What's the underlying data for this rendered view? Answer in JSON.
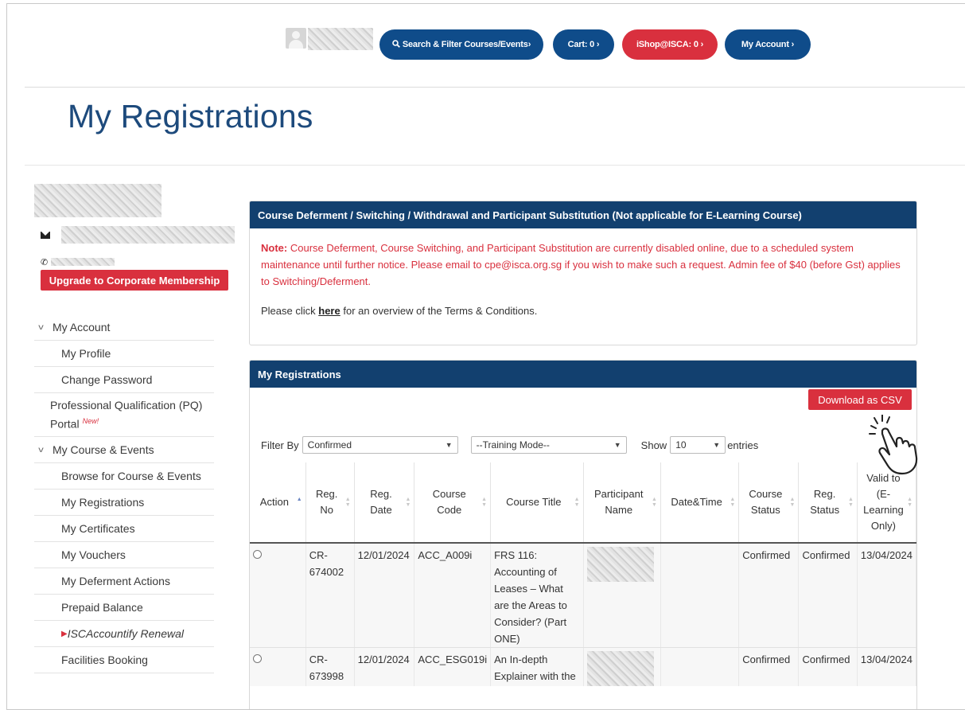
{
  "header": {
    "search_label": "Search & Filter Courses/Events",
    "cart_label": "Cart: 0",
    "ishop_label": "iShop@ISCA: 0",
    "account_label": "My Account",
    "search_icon": "search-icon",
    "chevron": "›"
  },
  "page_title": "My Registrations",
  "sidebar": {
    "upgrade_label": "Upgrade to Corporate Membership",
    "my_account": "My Account",
    "my_profile": "My Profile",
    "change_password": "Change Password",
    "pq_portal": "Professional Qualification (PQ) Portal",
    "new_badge": "New!",
    "my_course_events": "My Course & Events",
    "browse": "Browse for Course & Events",
    "my_registrations": "My Registrations",
    "my_certificates": "My Certificates",
    "my_vouchers": "My Vouchers",
    "my_deferment": "My Deferment Actions",
    "prepaid_balance": "Prepaid Balance",
    "accountify": "ISCAccountify Renewal",
    "facilities": "Facilities Booking"
  },
  "deferment_panel": {
    "title": "Course Deferment / Switching / Withdrawal and Participant Substitution (Not applicable for E-Learning Course)",
    "note_label": "Note:",
    "note_text": "Course Deferment, Course Switching, and Participant Substitution are currently disabled online, due to a scheduled system maintenance until further notice. Please email to cpe@isca.org.sg if you wish to make such a request. Admin fee of $40 (before Gst) applies to Switching/Deferment.",
    "tc_prefix": "Please click",
    "tc_link": "here",
    "tc_suffix": "for an overview of the Terms & Conditions."
  },
  "registrations_panel": {
    "title": "My Registrations",
    "download_label": "Download as CSV",
    "filter_by_label": "Filter By",
    "filter_value": "Confirmed",
    "training_mode_value": "--Training Mode--",
    "show_label": "Show",
    "entries_value": "10",
    "entries_label": "entries",
    "columns": [
      "Action",
      "Reg. No",
      "Reg. Date",
      "Course Code",
      "Course Title",
      "Participant Name",
      "Date&Time",
      "Course Status",
      "Reg. Status",
      "Valid to (E-Learning Only)"
    ],
    "rows": [
      {
        "reg_no": "CR-674002",
        "reg_date": "12/01/2024",
        "course_code": "ACC_A009i",
        "course_title": "FRS 116: Accounting of Leases – What are the Areas to Consider? (Part ONE)",
        "date_time": "",
        "course_status": "Confirmed",
        "reg_status": "Confirmed",
        "valid_to": "13/04/2024"
      },
      {
        "reg_no": "CR-673998",
        "reg_date": "12/01/2024",
        "course_code": "ACC_ESG019i",
        "course_title": "An In-depth Explainer with the",
        "date_time": "",
        "course_status": "Confirmed",
        "reg_status": "Confirmed",
        "valid_to": "13/04/2024"
      }
    ]
  },
  "colors": {
    "primary_blue": "#0f4c8a",
    "panel_header": "#12406f",
    "accent_red": "#d9303e",
    "title_blue": "#1d4a7c"
  }
}
